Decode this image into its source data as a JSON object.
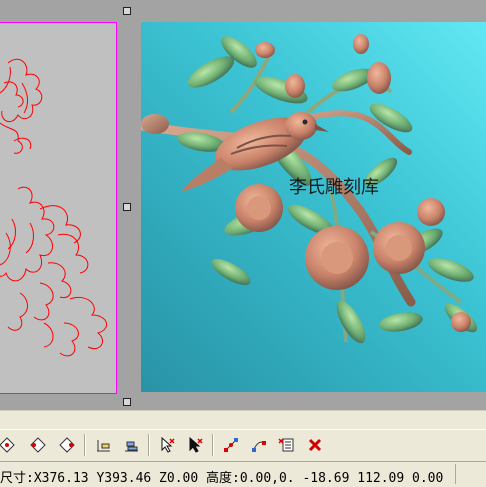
{
  "relief": {
    "watermark": "李氏雕刻库"
  },
  "status": {
    "text": "尺寸:X376.13 Y393.46 Z0.00 高度:0.00,0. -18.69 112.09 0.00"
  },
  "toolbar": {
    "icons": [
      "diamond-node-icon",
      "diamond-node-icon",
      "diamond-node-icon",
      "align-icon",
      "align-icon",
      "arrow-select-icon",
      "arrow-delete-icon",
      "node-edit-icon",
      "node-edit-icon",
      "list-edit-icon",
      "delete-x-icon"
    ]
  },
  "colors": {
    "canvas": "#a3a3a3",
    "vector_stroke": "#ff0000",
    "frame": "#ff00ff",
    "relief_light": "#62e8f4",
    "relief_dark": "#2a93a6",
    "delete": "#d40000"
  }
}
